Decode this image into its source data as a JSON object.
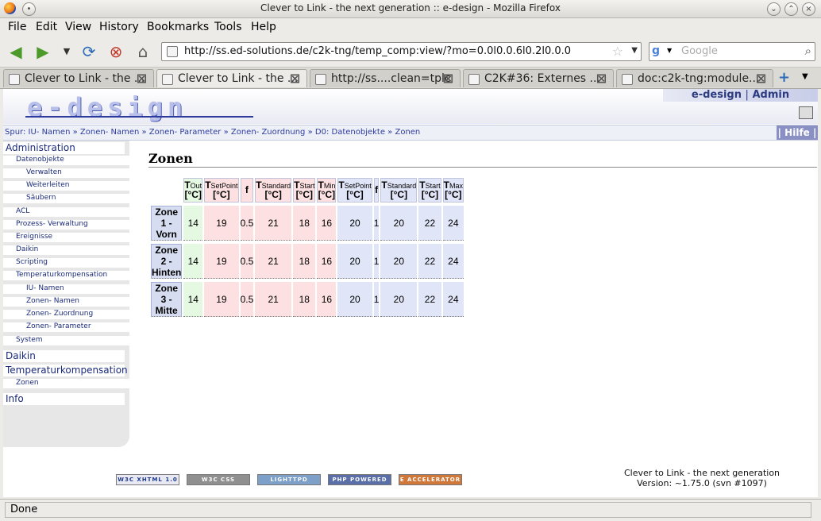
{
  "window": {
    "title": "Clever to Link - the next generation :: e-design - Mozilla Firefox"
  },
  "menu": [
    "File",
    "Edit",
    "View",
    "History",
    "Bookmarks",
    "Tools",
    "Help"
  ],
  "nav": {
    "url": "http://ss.ed-solutions.de/c2k-tng/temp_comp:view/?mo=0.0l0.0.6l0.2l0.0.0",
    "search_placeholder": "Google"
  },
  "tabs": [
    {
      "label": "Clever to Link - the ..."
    },
    {
      "label": "Clever to Link - the ..."
    },
    {
      "label": "http://ss....clean=tplc"
    },
    {
      "label": "C2K#36: Externes ..."
    },
    {
      "label": "doc:c2k-tng:module..."
    }
  ],
  "header": {
    "logo": "e-design",
    "user": "e-design",
    "separator": "|",
    "admin": "Admin"
  },
  "trail": {
    "text": "Spur: IU- Namen » Zonen- Namen » Zonen- Parameter » Zonen- Zuordnung » D0: Datenobjekte » Zonen",
    "help": "| Hilfe |"
  },
  "sidebar": [
    {
      "label": "Administration",
      "level": 0
    },
    {
      "label": "Datenobjekte",
      "level": 1
    },
    {
      "label": "Verwalten",
      "level": 2
    },
    {
      "label": "Weiterleiten",
      "level": 2
    },
    {
      "label": "Säubern",
      "level": 2
    },
    {
      "label": "ACL",
      "level": 1
    },
    {
      "label": "Prozess- Verwaltung",
      "level": 1
    },
    {
      "label": "Ereignisse",
      "level": 1
    },
    {
      "label": "Daikin",
      "level": 1
    },
    {
      "label": "Scripting",
      "level": 1
    },
    {
      "label": "Temperaturkompensation",
      "level": 1
    },
    {
      "label": "IU- Namen",
      "level": 2
    },
    {
      "label": "Zonen- Namen",
      "level": 2
    },
    {
      "label": "Zonen- Zuordnung",
      "level": 2
    },
    {
      "label": "Zonen- Parameter",
      "level": 2
    },
    {
      "label": "System",
      "level": 1
    },
    {
      "label": "Daikin",
      "level": 0
    },
    {
      "label": "Temperaturkompensation",
      "level": 0
    },
    {
      "label": "Zonen",
      "level": 1
    },
    {
      "label": "Info",
      "level": 0
    }
  ],
  "content": {
    "heading": "Zonen",
    "columns": [
      {
        "t": "T",
        "sub": "Out",
        "unit": "[°C]",
        "color": "green"
      },
      {
        "t": "T",
        "sub": "SetPoint",
        "unit": "[°C]",
        "color": "pink"
      },
      {
        "t": "f",
        "sub": "",
        "unit": "",
        "color": "pink"
      },
      {
        "t": "T",
        "sub": "Standard",
        "unit": "[°C]",
        "color": "pink"
      },
      {
        "t": "T",
        "sub": "Start",
        "unit": "[°C]",
        "color": "pink"
      },
      {
        "t": "T",
        "sub": "Min",
        "unit": "[°C]",
        "color": "pink"
      },
      {
        "t": "T",
        "sub": "SetPoint",
        "unit": "[°C]",
        "color": "blue"
      },
      {
        "t": "f",
        "sub": "",
        "unit": "",
        "color": "blue"
      },
      {
        "t": "T",
        "sub": "Standard",
        "unit": "[°C]",
        "color": "blue"
      },
      {
        "t": "T",
        "sub": "Start",
        "unit": "[°C]",
        "color": "blue"
      },
      {
        "t": "T",
        "sub": "Max",
        "unit": "[°C]",
        "color": "blue"
      }
    ],
    "rows": [
      {
        "name": "Zone 1 - Vorn",
        "values": [
          "14",
          "19",
          "0.5",
          "21",
          "18",
          "16",
          "20",
          "1",
          "20",
          "22",
          "24"
        ]
      },
      {
        "name": "Zone 2 - Hinten",
        "values": [
          "14",
          "19",
          "0.5",
          "21",
          "18",
          "16",
          "20",
          "1",
          "20",
          "22",
          "24"
        ]
      },
      {
        "name": "Zone 3 - Mitte",
        "values": [
          "14",
          "19",
          "0.5",
          "21",
          "18",
          "16",
          "20",
          "1",
          "20",
          "22",
          "24"
        ]
      }
    ]
  },
  "footer": {
    "badges": [
      "W3C XHTML 1.0",
      "W3C CSS",
      "LIGHTTPD",
      "PHP POWERED",
      "E ACCELERATOR"
    ],
    "product": "Clever to Link - the next generation",
    "version": "Version: ~1.75.0 (svn #1097)"
  },
  "status": "Done",
  "colors": {
    "green": "#e4f8e2",
    "pink": "#fde0e1",
    "blue": "#e1e5f8",
    "zone_head": "#d7ddf0",
    "link": "#1a2a7a"
  }
}
